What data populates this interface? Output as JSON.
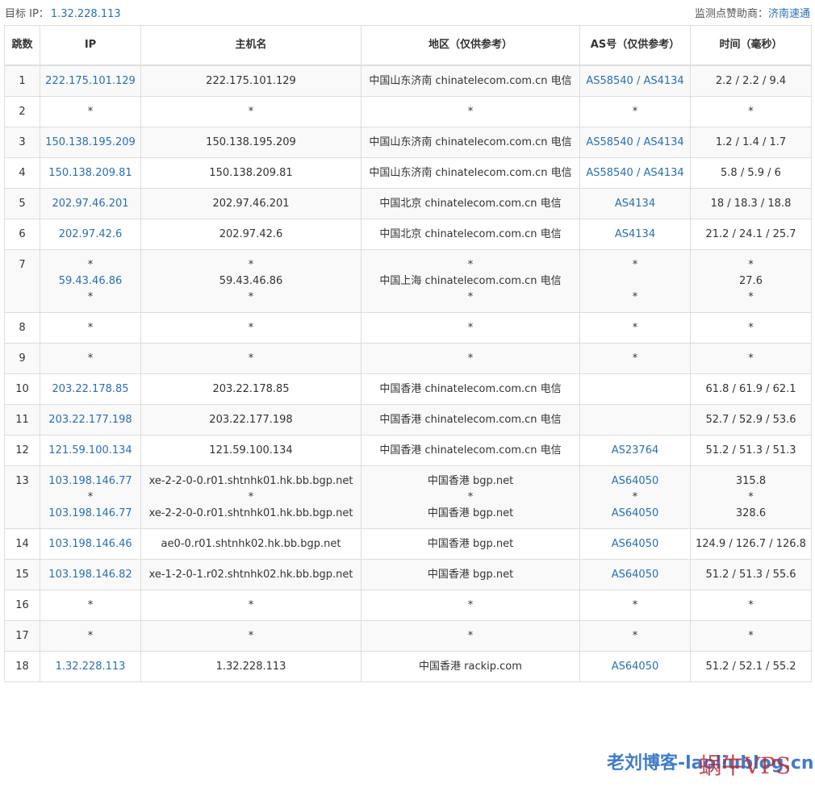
{
  "header": {
    "target_label": "目标 IP：",
    "target_ip": "1.32.228.113",
    "sponsor_label": "监测点赞助商：",
    "sponsor_name": "济南速通"
  },
  "columns": [
    "跳数",
    "IP",
    "主机名",
    "地区（仅供参考）",
    "AS号（仅供参考）",
    "时间（毫秒）"
  ],
  "rows": [
    {
      "hop": "1",
      "ip": [
        "222.175.101.129"
      ],
      "host": [
        "222.175.101.129"
      ],
      "region": [
        "中国山东济南 chinatelecom.com.cn 电信"
      ],
      "as": [
        "AS58540 / AS4134"
      ],
      "time": [
        "2.2 / 2.2 / 9.4"
      ]
    },
    {
      "hop": "2",
      "ip": [
        "*"
      ],
      "host": [
        "*"
      ],
      "region": [
        "*"
      ],
      "as": [
        "*"
      ],
      "time": [
        "*"
      ]
    },
    {
      "hop": "3",
      "ip": [
        "150.138.195.209"
      ],
      "host": [
        "150.138.195.209"
      ],
      "region": [
        "中国山东济南 chinatelecom.com.cn 电信"
      ],
      "as": [
        "AS58540 / AS4134"
      ],
      "time": [
        "1.2 / 1.4 / 1.7"
      ]
    },
    {
      "hop": "4",
      "ip": [
        "150.138.209.81"
      ],
      "host": [
        "150.138.209.81"
      ],
      "region": [
        "中国山东济南 chinatelecom.com.cn 电信"
      ],
      "as": [
        "AS58540 / AS4134"
      ],
      "time": [
        "5.8 / 5.9 / 6"
      ]
    },
    {
      "hop": "5",
      "ip": [
        "202.97.46.201"
      ],
      "host": [
        "202.97.46.201"
      ],
      "region": [
        "中国北京 chinatelecom.com.cn 电信"
      ],
      "as": [
        "AS4134"
      ],
      "time": [
        "18 / 18.3 / 18.8"
      ]
    },
    {
      "hop": "6",
      "ip": [
        "202.97.42.6"
      ],
      "host": [
        "202.97.42.6"
      ],
      "region": [
        "中国北京 chinatelecom.com.cn 电信"
      ],
      "as": [
        "AS4134"
      ],
      "time": [
        "21.2 / 24.1 / 25.7"
      ]
    },
    {
      "hop": "7",
      "ip": [
        "*",
        "59.43.46.86",
        "*"
      ],
      "host": [
        "*",
        "59.43.46.86",
        "*"
      ],
      "region": [
        "*",
        "中国上海 chinatelecom.com.cn 电信",
        "*"
      ],
      "as": [
        "*",
        "",
        "*"
      ],
      "time": [
        "*",
        "27.6",
        "*"
      ]
    },
    {
      "hop": "8",
      "ip": [
        "*"
      ],
      "host": [
        "*"
      ],
      "region": [
        "*"
      ],
      "as": [
        "*"
      ],
      "time": [
        "*"
      ]
    },
    {
      "hop": "9",
      "ip": [
        "*"
      ],
      "host": [
        "*"
      ],
      "region": [
        "*"
      ],
      "as": [
        "*"
      ],
      "time": [
        "*"
      ]
    },
    {
      "hop": "10",
      "ip": [
        "203.22.178.85"
      ],
      "host": [
        "203.22.178.85"
      ],
      "region": [
        "中国香港 chinatelecom.com.cn 电信"
      ],
      "as": [
        ""
      ],
      "time": [
        "61.8 / 61.9 / 62.1"
      ]
    },
    {
      "hop": "11",
      "ip": [
        "203.22.177.198"
      ],
      "host": [
        "203.22.177.198"
      ],
      "region": [
        "中国香港 chinatelecom.com.cn 电信"
      ],
      "as": [
        ""
      ],
      "time": [
        "52.7 / 52.9 / 53.6"
      ]
    },
    {
      "hop": "12",
      "ip": [
        "121.59.100.134"
      ],
      "host": [
        "121.59.100.134"
      ],
      "region": [
        "中国香港 chinatelecom.com.cn 电信"
      ],
      "as": [
        "AS23764"
      ],
      "time": [
        "51.2 / 51.3 / 51.3"
      ]
    },
    {
      "hop": "13",
      "ip": [
        "103.198.146.77",
        "*",
        "103.198.146.77"
      ],
      "host": [
        "xe-2-2-0-0.r01.shtnhk01.hk.bb.bgp.net",
        "*",
        "xe-2-2-0-0.r01.shtnhk01.hk.bb.bgp.net"
      ],
      "region": [
        "中国香港 bgp.net",
        "*",
        "中国香港 bgp.net"
      ],
      "as": [
        "AS64050",
        "*",
        "AS64050"
      ],
      "time": [
        "315.8",
        "*",
        "328.6"
      ]
    },
    {
      "hop": "14",
      "ip": [
        "103.198.146.46"
      ],
      "host": [
        "ae0-0.r01.shtnhk02.hk.bb.bgp.net"
      ],
      "region": [
        "中国香港 bgp.net"
      ],
      "as": [
        "AS64050"
      ],
      "time": [
        "124.9 / 126.7 / 126.8"
      ]
    },
    {
      "hop": "15",
      "ip": [
        "103.198.146.82"
      ],
      "host": [
        "xe-1-2-0-1.r02.shtnhk02.hk.bb.bgp.net"
      ],
      "region": [
        "中国香港 bgp.net"
      ],
      "as": [
        "AS64050"
      ],
      "time": [
        "51.2 / 51.3 / 55.6"
      ]
    },
    {
      "hop": "16",
      "ip": [
        "*"
      ],
      "host": [
        "*"
      ],
      "region": [
        "*"
      ],
      "as": [
        "*"
      ],
      "time": [
        "*"
      ]
    },
    {
      "hop": "17",
      "ip": [
        "*"
      ],
      "host": [
        "*"
      ],
      "region": [
        "*"
      ],
      "as": [
        "*"
      ],
      "time": [
        "*"
      ]
    },
    {
      "hop": "18",
      "ip": [
        "1.32.228.113"
      ],
      "host": [
        "1.32.228.113"
      ],
      "region": [
        "中国香港 rackip.com"
      ],
      "as": [
        "AS64050"
      ],
      "time": [
        "51.2 / 52.1 / 55.2"
      ]
    }
  ],
  "watermark": {
    "text": "老刘博客-laoliublog.cn",
    "brand": "蜗牛VPS"
  }
}
